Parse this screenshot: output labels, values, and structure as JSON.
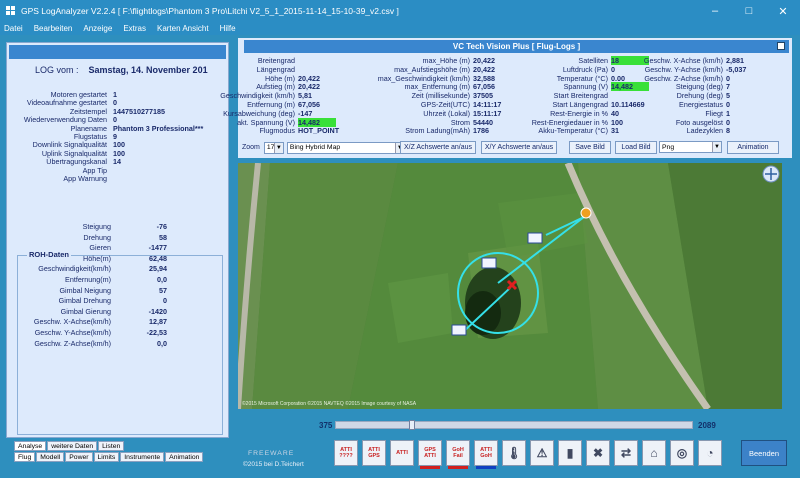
{
  "window": {
    "title": "GPS LogAnalyzer V2.2.4   [ F:\\flightlogs\\Phantom 3 Pro\\Litchi V2_5_1_2015-11-14_15-10-39_v2.csv ]"
  },
  "menu": [
    "Datei",
    "Bearbeiten",
    "Anzeige",
    "Extras",
    "Karten Ansicht",
    "Hilfe"
  ],
  "left": {
    "log_label": "LOG vom :",
    "log_date": "Samstag, 14. November 201",
    "info": [
      {
        "label": "Motoren gestartet",
        "value": "1"
      },
      {
        "label": "Videoaufnahme gestartet",
        "value": "0"
      },
      {
        "label": "Zeitstempel",
        "value": "1447510277185"
      },
      {
        "label": "Wiederverwendung Daten",
        "value": "0"
      },
      {
        "label": "Planename",
        "value": "Phantom 3 Professional***"
      },
      {
        "label": "Flugstatus",
        "value": "9"
      },
      {
        "label": "Downlink Signalqualität",
        "value": "100"
      },
      {
        "label": "Uplink Signalqualität",
        "value": "100"
      },
      {
        "label": "Übertragungskanal",
        "value": "14"
      },
      {
        "label": "App Tip",
        "value": ""
      },
      {
        "label": "App Warnung",
        "value": ""
      }
    ],
    "roh_title": "ROH-Daten",
    "roh": [
      {
        "label": "Steigung",
        "value": "-76"
      },
      {
        "label": "Drehung",
        "value": "58"
      },
      {
        "label": "Gieren",
        "value": "-1477"
      },
      {
        "label": "Höhe(m)",
        "value": "62,48"
      },
      {
        "label": "Geschwindigkeit(km/h)",
        "value": "25,94"
      },
      {
        "label": "Entfernung(m)",
        "value": "0,0"
      },
      {
        "label": "Gimbal Neigung",
        "value": "57"
      },
      {
        "label": "Gimbal Drehung",
        "value": "0"
      },
      {
        "label": "Gimbal Gierung",
        "value": "-1420"
      },
      {
        "label": "Geschw. X-Achse(km/h)",
        "value": "12,87"
      },
      {
        "label": "Geschw. Y-Achse(km/h)",
        "value": "-22,53"
      },
      {
        "label": "Geschw. Z-Achse(km/h)",
        "value": "0,0"
      }
    ],
    "tabs_row1": [
      "Analyse",
      "weitere Daten",
      "Listen"
    ],
    "tabs_row2": [
      "Flug",
      "Modell",
      "Power",
      "Limits",
      "Instrumente",
      "Animation"
    ]
  },
  "panel": {
    "title": "VC Tech Vision Plus [ Flug-Logs ]",
    "col1": [
      {
        "label": "Breitengrad",
        "value": ""
      },
      {
        "label": "Längengrad",
        "value": ""
      },
      {
        "label": "Höhe (m)",
        "value": "20,422"
      },
      {
        "label": "Aufstieg (m)",
        "value": "20,422"
      },
      {
        "label": "Geschwindigkeit (km/h)",
        "value": "5,81"
      },
      {
        "label": "Entfernung (m)",
        "value": "67,056"
      },
      {
        "label": "Kursabweichung (deg)",
        "value": "-147"
      },
      {
        "label": "akt. Spannung (V)",
        "value": "14,482"
      },
      {
        "label": "Flugmodus",
        "value": "HOT_POINT"
      }
    ],
    "col2": [
      {
        "label": "max_Höhe (m)",
        "value": "20,422"
      },
      {
        "label": "max_Aufstiegshöhe (m)",
        "value": "20,422"
      },
      {
        "label": "max_Geschwindigkeit (km/h)",
        "value": "32,588"
      },
      {
        "label": "max_Entfernung (m)",
        "value": "67,056"
      },
      {
        "label": "Zeit (millisekunde)",
        "value": "37505"
      },
      {
        "label": "GPS-Zeit(UTC)",
        "value": "14:11:17"
      },
      {
        "label": "Uhrzeit (Lokal)",
        "value": "15:11:17"
      },
      {
        "label": "Strom",
        "value": "54440"
      },
      {
        "label": "Strom Ladung(mAh)",
        "value": "1786"
      }
    ],
    "col3": [
      {
        "label": "Satelliten",
        "value": "18"
      },
      {
        "label": "Luftdruck (Pa)",
        "value": "0"
      },
      {
        "label": "Temperatur (°C)",
        "value": "0.00"
      },
      {
        "label": "Spannung (V)",
        "value": "14,482"
      },
      {
        "label": "Start Breitengrad",
        "value": ""
      },
      {
        "label": "Start Längengrad",
        "value": "10.114669"
      },
      {
        "label": "Rest-Energie in %",
        "value": "40"
      },
      {
        "label": "Rest-Energiedauer in %",
        "value": "100"
      },
      {
        "label": "Akku-Temperatur (°C)",
        "value": "31"
      }
    ],
    "col4": [
      {
        "label": "Geschw. X-Achse (km/h)",
        "value": "2,881"
      },
      {
        "label": "Geschw. Y-Achse (km/h)",
        "value": "-5,037"
      },
      {
        "label": "Geschw. Z-Achse (km/h)",
        "value": "0"
      },
      {
        "label": "Steigung (deg)",
        "value": "7"
      },
      {
        "label": "Drehung (deg)",
        "value": "5"
      },
      {
        "label": "Energiestatus",
        "value": "0"
      },
      {
        "label": "Fliegt",
        "value": "1"
      },
      {
        "label": "Foto ausgelöst",
        "value": "0"
      },
      {
        "label": "Ladezyklen",
        "value": "8"
      }
    ],
    "zoom_label": "Zoom",
    "zoom_value": "17",
    "map_type": "Bing Hybrid Map",
    "btn_xz": "X/Z Achswerte an/aus",
    "btn_xy": "X/Y Achswerte an/aus",
    "btn_save": "Save Bild",
    "btn_load": "Load Bild",
    "format": "Png",
    "btn_anim": "Animation"
  },
  "map": {
    "copyright": "©2015 Microsoft Corporation  ©2015 NAVTEQ  ©2015 Image courtesy of NASA"
  },
  "bottom": {
    "start": "375",
    "end": "2089",
    "freeware": "FREEWARE",
    "copyright": "©2015  bei D.Teichert",
    "tools": [
      {
        "name": "atti-help-tool",
        "t1": "ATTI",
        "t2": "????",
        "bar": ""
      },
      {
        "name": "atti-gps-tool",
        "t1": "ATTI",
        "t2": "GPS",
        "bar": ""
      },
      {
        "name": "atti-tool",
        "t1": "ATTI",
        "t2": "",
        "bar": ""
      },
      {
        "name": "gps-atti-tool",
        "t1": "GPS",
        "t2": "ATTI",
        "bar": "#d02020"
      },
      {
        "name": "gps-fail-tool",
        "t1": "GoH",
        "t2": "Fail",
        "bar": "#d02020"
      },
      {
        "name": "atti-goh-tool",
        "t1": "ATTI",
        "t2": "GoH",
        "bar": "#1040c0"
      },
      {
        "name": "thermometer-tool",
        "t1": "",
        "t2": "",
        "bar": ""
      },
      {
        "name": "warning-tool",
        "t1": "",
        "t2": "",
        "bar": ""
      },
      {
        "name": "battery-tool",
        "t1": "",
        "t2": "",
        "bar": ""
      },
      {
        "name": "drone-delete-tool",
        "t1": "",
        "t2": "",
        "bar": ""
      },
      {
        "name": "drone-transfer-tool",
        "t1": "",
        "t2": "",
        "bar": ""
      },
      {
        "name": "home-tool",
        "t1": "",
        "t2": "",
        "bar": ""
      },
      {
        "name": "target-tool",
        "t1": "",
        "t2": "",
        "bar": ""
      },
      {
        "name": "radar-tool",
        "t1": "",
        "t2": "",
        "bar": ""
      }
    ],
    "beenden": "Beenden"
  }
}
